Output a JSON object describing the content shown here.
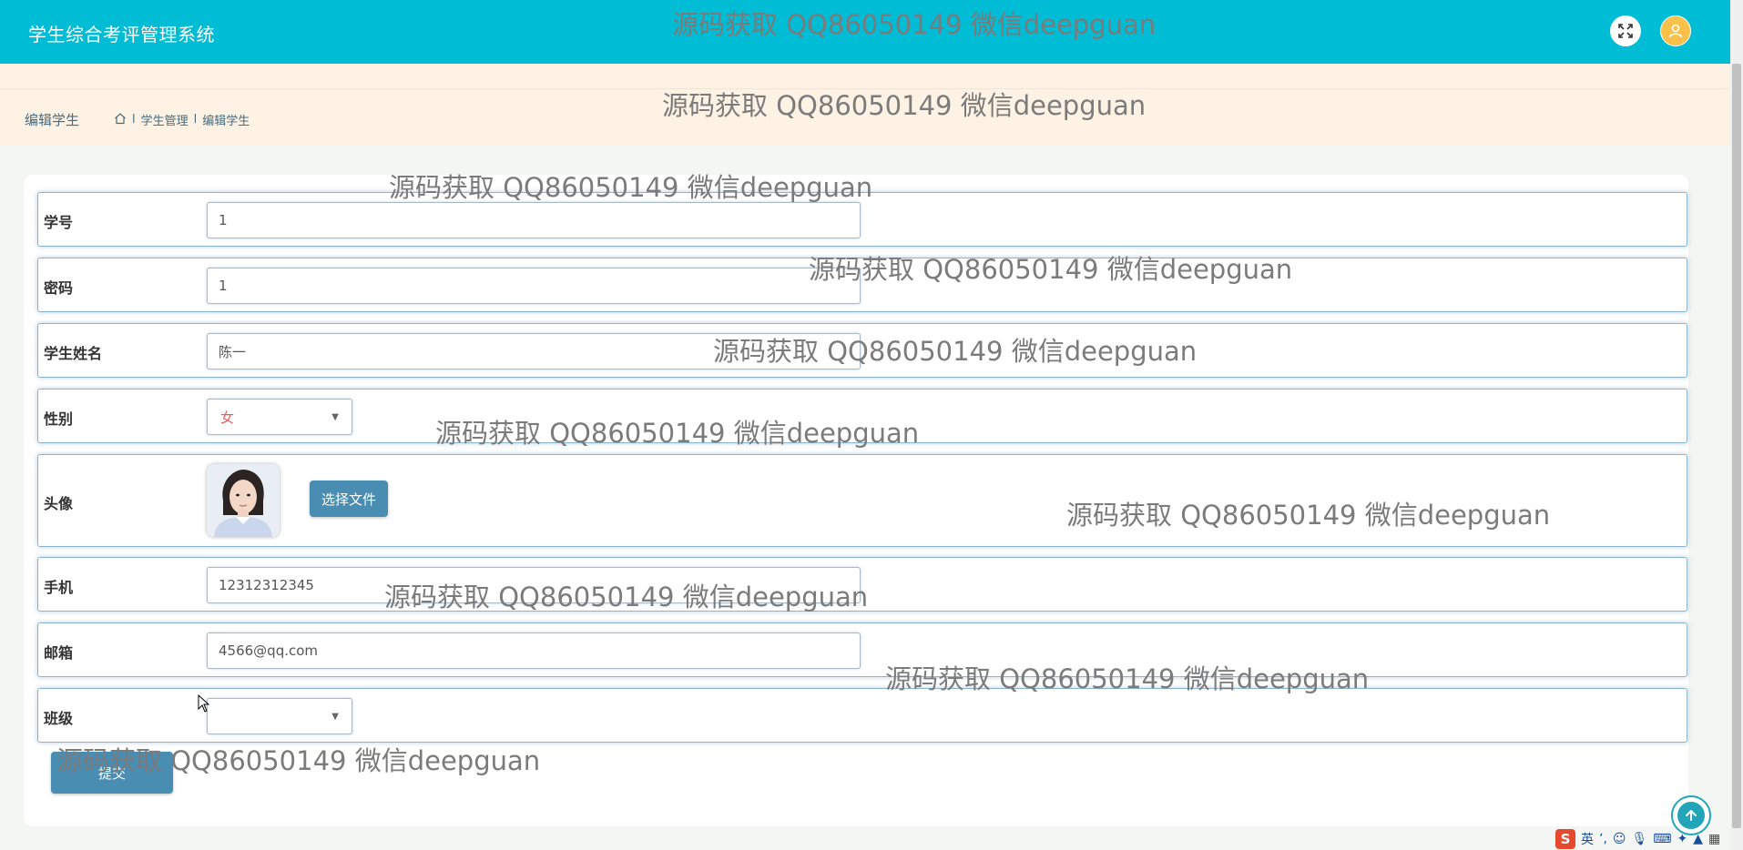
{
  "app": {
    "title": "学生综合考评管理系统"
  },
  "header": {
    "fullscreen_icon": "fullscreen-toggle-icon",
    "avatar_icon": "user-avatar-icon"
  },
  "breadcrumb": {
    "page_title": "编辑学生",
    "home_icon": "home-icon",
    "separator": "l",
    "items": [
      "学生管理",
      "编辑学生"
    ]
  },
  "form": {
    "fields": {
      "student_id": {
        "label": "学号",
        "value": "1"
      },
      "password": {
        "label": "密码",
        "value": "1"
      },
      "name": {
        "label": "学生姓名",
        "value": "陈一"
      },
      "gender": {
        "label": "性别",
        "value": "女"
      },
      "avatar": {
        "label": "头像",
        "button_label": "选择文件"
      },
      "phone": {
        "label": "手机",
        "value": "12312312345"
      },
      "email": {
        "label": "邮箱",
        "value": "4566@qq.com"
      },
      "class": {
        "label": "班级",
        "value": ""
      }
    },
    "submit_label": "提交"
  },
  "watermark": {
    "text": "源码获取 QQ86050149 微信deepguan",
    "count": 10
  },
  "ime": {
    "lang": "英"
  },
  "colors": {
    "topbar": "#00bcd4",
    "crumb_band": "#fdf2e4",
    "button": "#4a8db3",
    "row_border": "#8bb4cf",
    "select_text": "#e06060"
  }
}
